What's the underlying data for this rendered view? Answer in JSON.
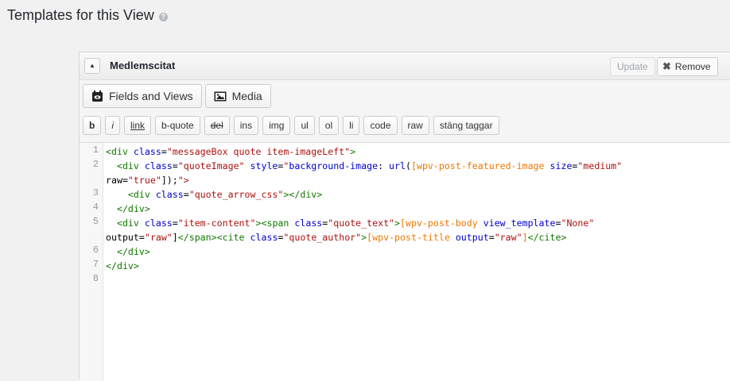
{
  "page": {
    "title": "Templates for this View",
    "help": "?"
  },
  "panel": {
    "collapse_icon": "▲",
    "title": "Medlemscitat",
    "update_label": "Update",
    "remove_label": "Remove",
    "remove_icon": "✖"
  },
  "toolbar": {
    "fields_views_label": "Fields and Views",
    "media_label": "Media",
    "quicktags": {
      "b": "b",
      "i": "i",
      "link": "link",
      "bquote": "b-quote",
      "del": "del",
      "ins": "ins",
      "img": "img",
      "ul": "ul",
      "ol": "ol",
      "li": "li",
      "code": "code",
      "raw": "raw",
      "close": "stäng taggar"
    }
  },
  "editor": {
    "line_numbers": [
      "1",
      "2",
      "3",
      "4",
      "5",
      "6",
      "7",
      "8"
    ],
    "lines": [
      "<div class=\"messageBox quote item-imageLeft\">",
      "  <div class=\"quoteImage\" style=\"background-image: url([wpv-post-featured-image size=\"medium\"",
      "raw=\"true\"]);\">",
      "    <div class=\"quote_arrow_css\"></div>",
      "  </div>",
      "  <div class=\"item-content\"><span class=\"quote_text\">[wpv-post-body view_template=\"None\"",
      "output=\"raw\"]</span><cite class=\"quote_author\">[wpv-post-title output=\"raw\"]</cite>",
      "  </div>",
      "</div>",
      ""
    ]
  }
}
